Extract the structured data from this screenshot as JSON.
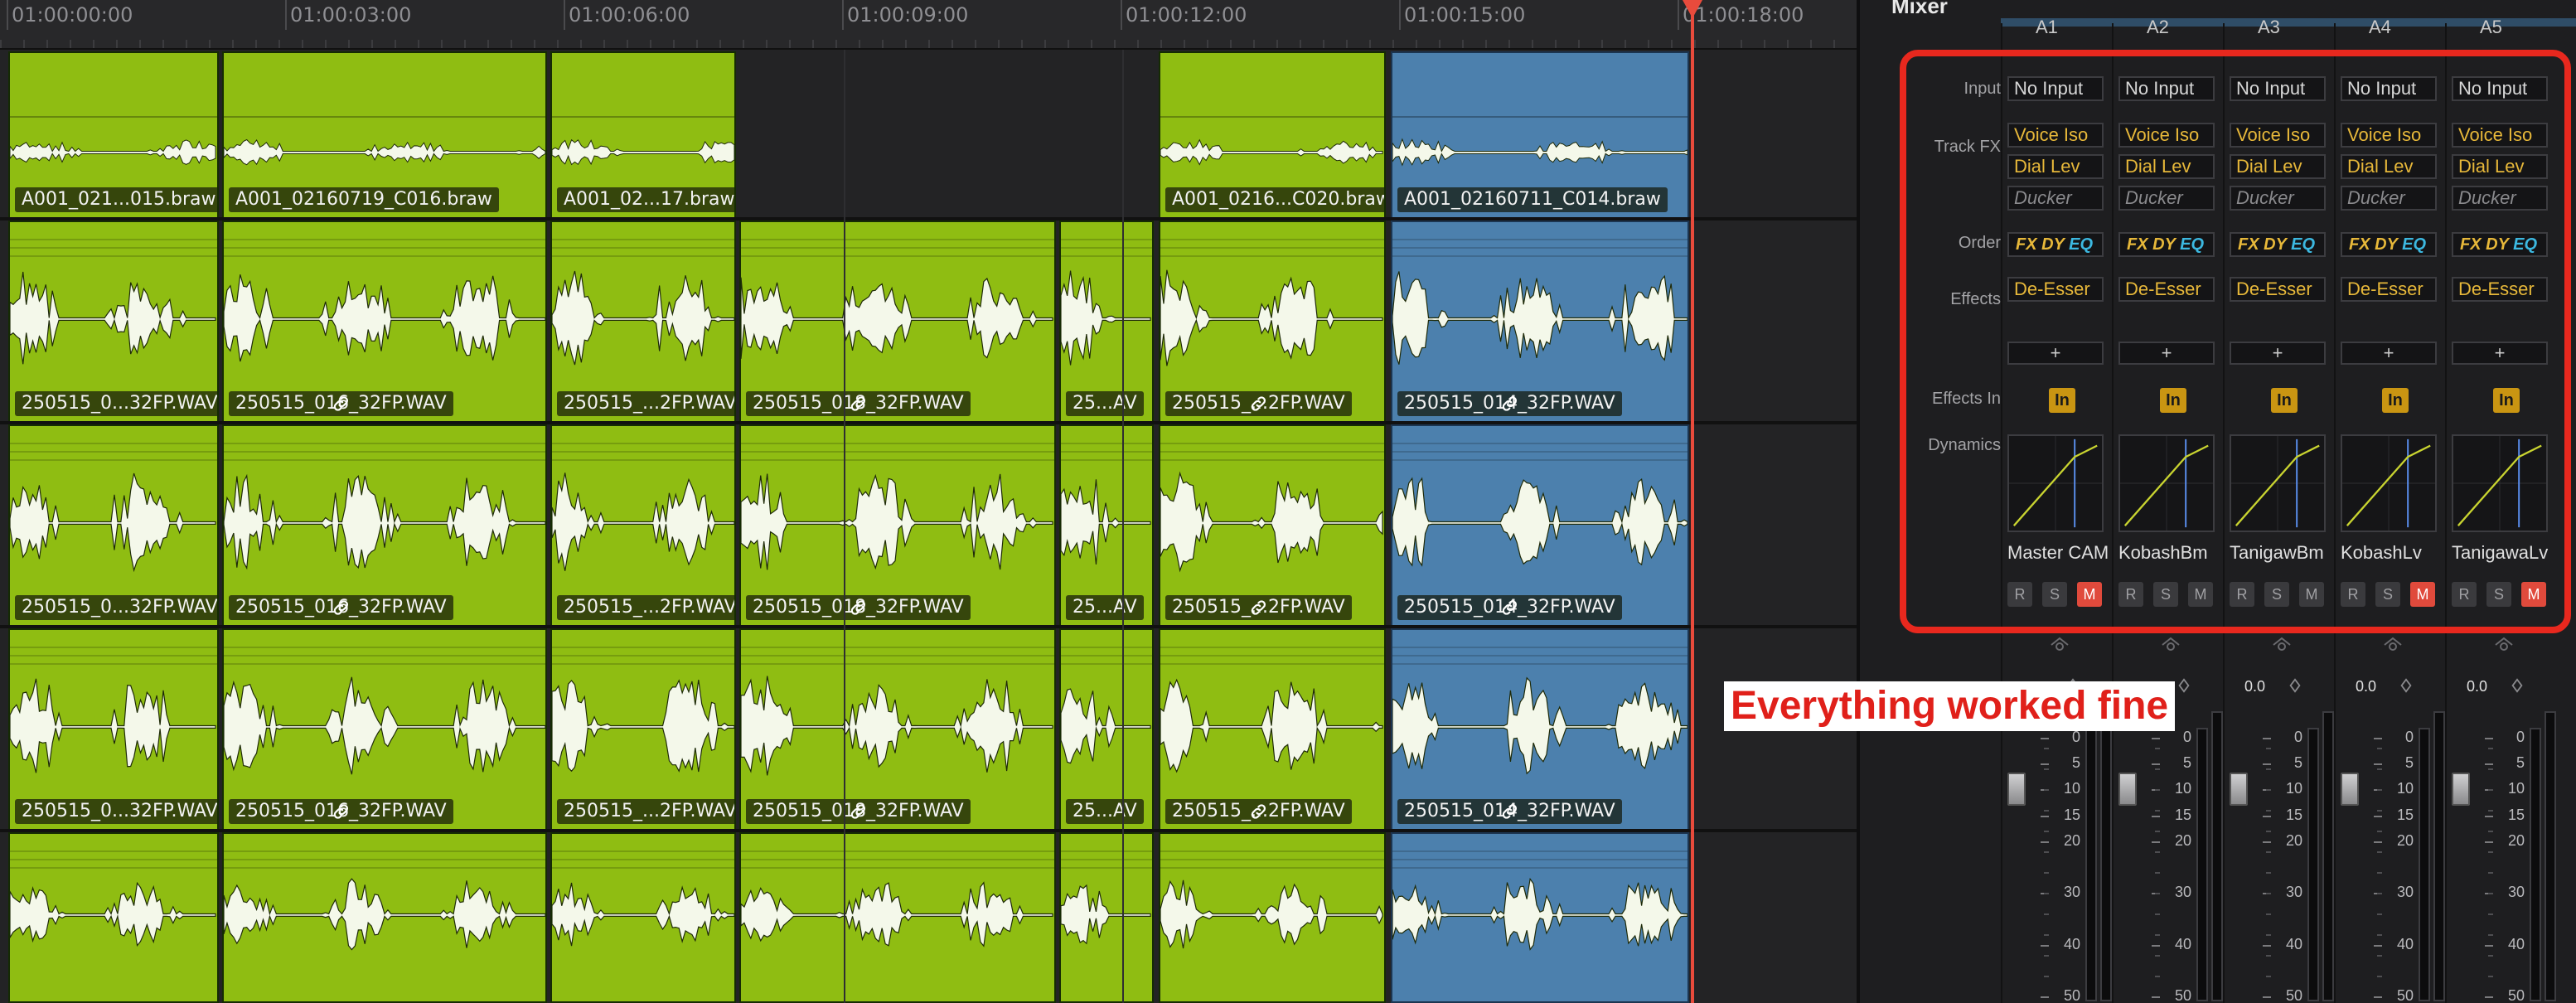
{
  "ruler": {
    "ticks": [
      "01:00:00:00",
      "01:00:03:00",
      "01:00:06:00",
      "01:00:09:00",
      "01:00:12:00",
      "01:00:15:00",
      "01:00:18:00"
    ]
  },
  "tracks": [
    {
      "clips": [
        {
          "label": "A001_021...015.braw",
          "color": "green",
          "link": false
        },
        {
          "label": "A001_02160719_C016.braw",
          "color": "green",
          "link": false
        },
        {
          "label": "A001_02...17.braw",
          "color": "green",
          "link": false
        },
        {
          "label": "A001_0216...C020.braw",
          "color": "green",
          "link": false
        },
        {
          "label": "A001_02160711_C014.braw",
          "color": "blue",
          "link": false
        }
      ]
    },
    {
      "clips": [
        {
          "label": "250515_0...32FP.WAV",
          "color": "green",
          "link": false
        },
        {
          "label": "250515_016_32FP.WAV",
          "color": "green",
          "link": true
        },
        {
          "label": "250515_...2FP.WAV",
          "color": "green",
          "link": false
        },
        {
          "label": "250515_018_32FP.WAV",
          "color": "green",
          "link": true
        },
        {
          "label": "25...AV",
          "color": "green",
          "link": false
        },
        {
          "label": "250515_...2FP.WAV",
          "color": "green",
          "link": true
        },
        {
          "label": "250515_014_32FP.WAV",
          "color": "blue",
          "link": true
        }
      ]
    },
    {
      "clips": [
        {
          "label": "250515_0...32FP.WAV",
          "color": "green",
          "link": false
        },
        {
          "label": "250515_016_32FP.WAV",
          "color": "green",
          "link": true
        },
        {
          "label": "250515_...2FP.WAV",
          "color": "green",
          "link": false
        },
        {
          "label": "250515_018_32FP.WAV",
          "color": "green",
          "link": true
        },
        {
          "label": "25...AV",
          "color": "green",
          "link": false
        },
        {
          "label": "250515_...2FP.WAV",
          "color": "green",
          "link": true
        },
        {
          "label": "250515_014_32FP.WAV",
          "color": "blue",
          "link": true
        }
      ]
    },
    {
      "clips": [
        {
          "label": "250515_0...32FP.WAV",
          "color": "green",
          "link": false
        },
        {
          "label": "250515_016_32FP.WAV",
          "color": "green",
          "link": true
        },
        {
          "label": "250515_...2FP.WAV",
          "color": "green",
          "link": false
        },
        {
          "label": "250515_018_32FP.WAV",
          "color": "green",
          "link": true
        },
        {
          "label": "25...AV",
          "color": "green",
          "link": false
        },
        {
          "label": "250515_...2FP.WAV",
          "color": "green",
          "link": true
        },
        {
          "label": "250515_014_32FP.WAV",
          "color": "blue",
          "link": true
        }
      ]
    },
    {
      "clips": [
        {
          "label": "",
          "color": "green",
          "link": false
        },
        {
          "label": "",
          "color": "green",
          "link": false
        },
        {
          "label": "",
          "color": "green",
          "link": false
        },
        {
          "label": "",
          "color": "green",
          "link": false
        },
        {
          "label": "",
          "color": "green",
          "link": false
        },
        {
          "label": "",
          "color": "green",
          "link": false
        },
        {
          "label": "",
          "color": "blue",
          "link": false
        }
      ]
    }
  ],
  "mixer": {
    "title": "Mixer",
    "row_labels": {
      "input": "Input",
      "track_fx": "Track FX",
      "order": "Order",
      "effects": "Effects",
      "effects_in": "Effects In",
      "dynamics": "Dynamics"
    },
    "order_parts": {
      "fx": "FX",
      "dy": "DY",
      "eq": "EQ"
    },
    "plus": "+",
    "in_label": "In",
    "rsm": {
      "r": "R",
      "s": "S",
      "m": "M"
    },
    "channels": [
      {
        "header": "A1",
        "input": "No Input",
        "fx": [
          "Voice Iso",
          "Dial Lev",
          "Ducker"
        ],
        "effect": "De-Esser",
        "name": "Master CAM",
        "mute": true,
        "level": "",
        "fader_db": 10
      },
      {
        "header": "A2",
        "input": "No Input",
        "fx": [
          "Voice Iso",
          "Dial Lev",
          "Ducker"
        ],
        "effect": "De-Esser",
        "name": "KobashBm",
        "mute": false,
        "level": "",
        "fader_db": 10
      },
      {
        "header": "A3",
        "input": "No Input",
        "fx": [
          "Voice Iso",
          "Dial Lev",
          "Ducker"
        ],
        "effect": "De-Esser",
        "name": "TanigawBm",
        "mute": false,
        "level": "0.0",
        "fader_db": 10
      },
      {
        "header": "A4",
        "input": "No Input",
        "fx": [
          "Voice Iso",
          "Dial Lev",
          "Ducker"
        ],
        "effect": "De-Esser",
        "name": "KobashLv",
        "mute": true,
        "level": "0.0",
        "fader_db": 10
      },
      {
        "header": "A5",
        "input": "No Input",
        "fx": [
          "Voice Iso",
          "Dial Lev",
          "Ducker"
        ],
        "effect": "De-Esser",
        "name": "TanigawaLv",
        "mute": true,
        "level": "0.0",
        "fader_db": 10
      }
    ],
    "fader_scale": [
      "0",
      "5",
      "10",
      "15",
      "20",
      "30",
      "40",
      "50"
    ]
  },
  "annotation": "Everything worked fine",
  "colors": {
    "clip_green": "#8fbd12",
    "clip_blue": "#4c80ad",
    "playhead": "#e84b3c",
    "highlight": "#e8281e",
    "fx_text": "#e7b83a"
  }
}
